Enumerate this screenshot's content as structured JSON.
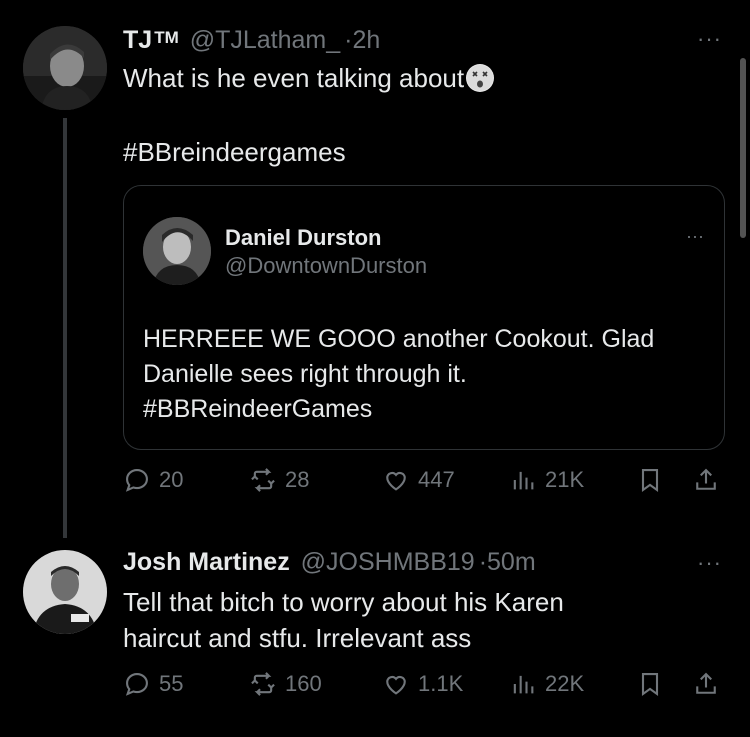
{
  "tweet1": {
    "name": "TJ",
    "name_suffix": "TM",
    "handle": "@TJLatham_",
    "separator": "·",
    "time": "2h",
    "text": "What is he even talking about",
    "hashtag": "#BBreindeergames",
    "more": "···",
    "quote": {
      "name": "Daniel Durston",
      "handle": "@DowntownDurston",
      "more": "···",
      "line1": "HERREEE WE GOOO another Cookout. Glad",
      "line2": "Danielle sees right through it.",
      "hashtag": "#BBReindeerGames"
    },
    "actions": {
      "replies": "20",
      "reposts": "28",
      "likes": "447",
      "views": "21K"
    }
  },
  "tweet2": {
    "name": "Josh Martinez",
    "handle": "@JOSHMBB19",
    "separator": "·",
    "time": "50m",
    "line1": "Tell that bitch to worry about his Karen",
    "line2": "haircut and stfu. Irrelevant ass",
    "more": "···",
    "actions": {
      "replies": "55",
      "reposts": "160",
      "likes": "1.1K",
      "views": "22K"
    }
  },
  "colors": {
    "background": "#000000",
    "text": "#e7e9ea",
    "muted": "#71767b",
    "border": "#2f3336"
  }
}
